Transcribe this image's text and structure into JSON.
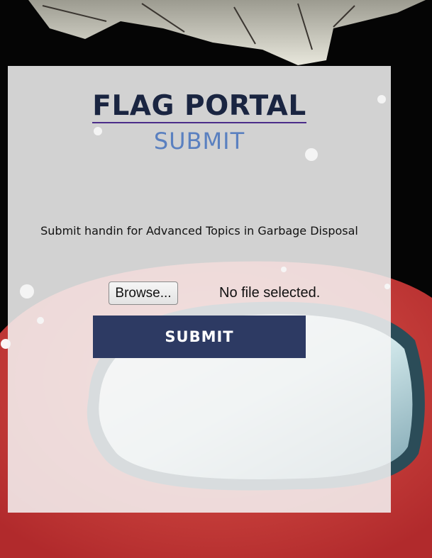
{
  "header": {
    "title": "FLAG PORTAL",
    "subtitle": "SUBMIT"
  },
  "form": {
    "description": "Submit handin for Advanced Topics in Garbage Disposal",
    "browse_label": "Browse...",
    "file_status": "No file selected.",
    "submit_label": "SUBMIT"
  },
  "colors": {
    "title": "#1a2541",
    "subtitle": "#5a80c0",
    "submit_bg": "#2d3a63",
    "title_underline": "#4b2d8a",
    "background_accent": "#d6453b"
  }
}
